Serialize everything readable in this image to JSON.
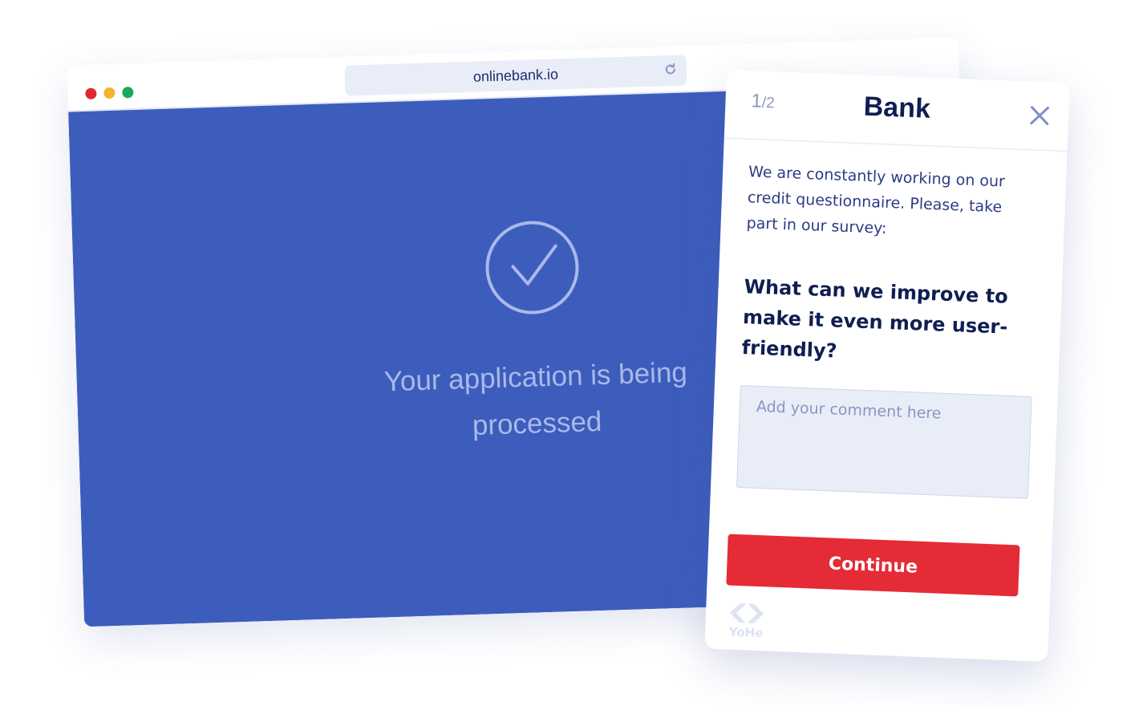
{
  "browser": {
    "traffic_lights": {
      "close_color": "#e0262f",
      "minimize_color": "#f5b333",
      "maximize_color": "#19a85a"
    },
    "address": "onlinebank.io",
    "refresh_icon": "refresh-icon",
    "page_background": "#3d5dbd",
    "status_icon": "checkmark-circle-icon",
    "status_text": "Your application is being processed"
  },
  "survey": {
    "step": {
      "current": "1",
      "separator": "/",
      "total": "2"
    },
    "title": "Bank",
    "close_icon": "close-icon",
    "intro": "We are constantly working on our credit questionnaire. Please, take part in our survey:",
    "question": "What can we improve to make it even more user-friendly?",
    "comment": {
      "value": "",
      "placeholder": "Add your comment here"
    },
    "continue_label": "Continue",
    "accent_color": "#e52b36",
    "brand": {
      "icon": "yohe-logo-icon",
      "name": "YoHe"
    }
  }
}
